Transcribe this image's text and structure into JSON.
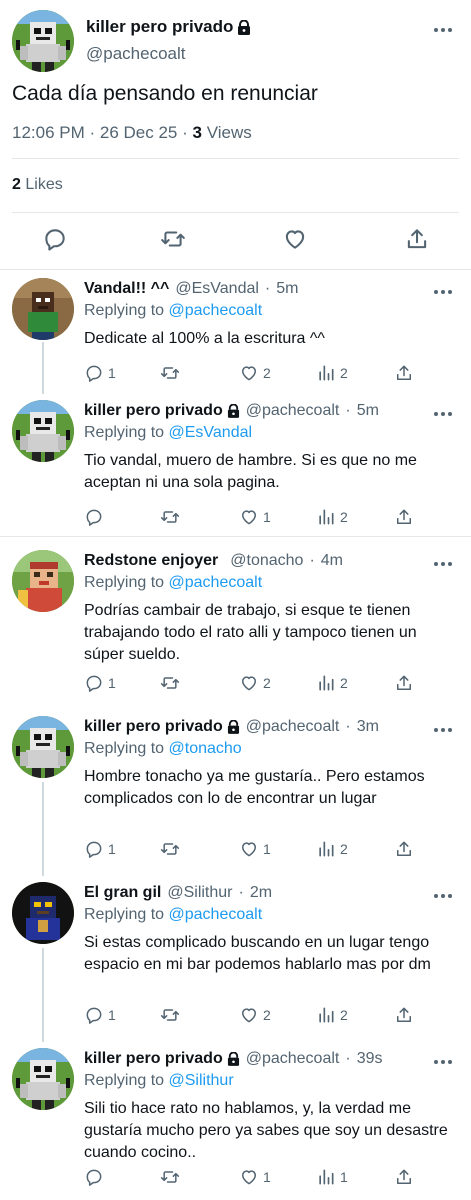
{
  "main_tweet": {
    "author_name": "killer pero privado",
    "handle": "@pachecoalt",
    "text": "Cada día pensando en renunciar",
    "time": "12:06 PM",
    "date": "26 Dec 25",
    "views_count": "3",
    "views_label": "Views",
    "likes_count": "2",
    "likes_label": "Likes"
  },
  "replies": [
    {
      "author_name": "Vandal!! ^^",
      "handle": "@EsVandal",
      "time": "5m",
      "locked": false,
      "replying_label": "Replying to",
      "replying_to": "@pachecoalt",
      "text": "Dedicate al 100% a la escritura ^^",
      "replies": "1",
      "likes": "2",
      "views": "2",
      "avatar": "dark-skin"
    },
    {
      "author_name": "killer pero privado",
      "handle": "@pachecoalt",
      "time": "5m",
      "locked": true,
      "replying_label": "Replying to",
      "replying_to": "@EsVandal",
      "text": "Tio vandal, muero de hambre. Si es que no me aceptan ni una sola pagina.",
      "replies": "",
      "likes": "1",
      "views": "2",
      "avatar": "robot"
    },
    {
      "author_name": "Redstone enjoyer",
      "handle": "@tonacho",
      "time": "4m",
      "locked": false,
      "replying_label": "Replying to",
      "replying_to": "@pachecoalt",
      "text": "Podrías cambair de trabajo, si esque te tienen trabajando todo el rato alli y tampoco tienen un súper sueldo.",
      "replies": "1",
      "likes": "2",
      "views": "2",
      "avatar": "redstone"
    },
    {
      "author_name": "killer pero privado",
      "handle": "@pachecoalt",
      "time": "3m",
      "locked": true,
      "replying_label": "Replying to",
      "replying_to": "@tonacho",
      "text": "Hombre tonacho ya me gustaría.. Pero estamos complicados con lo de encontrar un lugar",
      "replies": "1",
      "likes": "1",
      "views": "2",
      "avatar": "robot"
    },
    {
      "author_name": "El gran gil",
      "handle": "@Silithur",
      "time": "2m",
      "locked": false,
      "replying_label": "Replying to",
      "replying_to": "@pachecoalt",
      "text": "Si estas complicado buscando en un lugar tengo espacio en mi bar podemos hablarlo mas por dm",
      "replies": "1",
      "likes": "2",
      "views": "2",
      "avatar": "dark"
    },
    {
      "author_name": "killer pero privado",
      "handle": "@pachecoalt",
      "time": "39s",
      "locked": true,
      "replying_label": "Replying to",
      "replying_to": "@Silithur",
      "text": "Sili tio hace rato no hablamos, y, la verdad me gustaría mucho pero ya sabes que soy un desastre cuando cocino..",
      "replies": "",
      "likes": "1",
      "views": "1",
      "avatar": "robot"
    }
  ],
  "colors": {
    "text": "#0f1419",
    "secondary": "#536471",
    "accent": "#1d9bf0",
    "divider": "#e7e7e7",
    "thread_line": "#cfd9de"
  },
  "icons": {
    "reply": "reply-icon",
    "retweet": "retweet-icon",
    "like": "heart-icon",
    "views": "views-icon",
    "share": "share-icon",
    "lock": "lock-icon",
    "more": "more-icon"
  }
}
